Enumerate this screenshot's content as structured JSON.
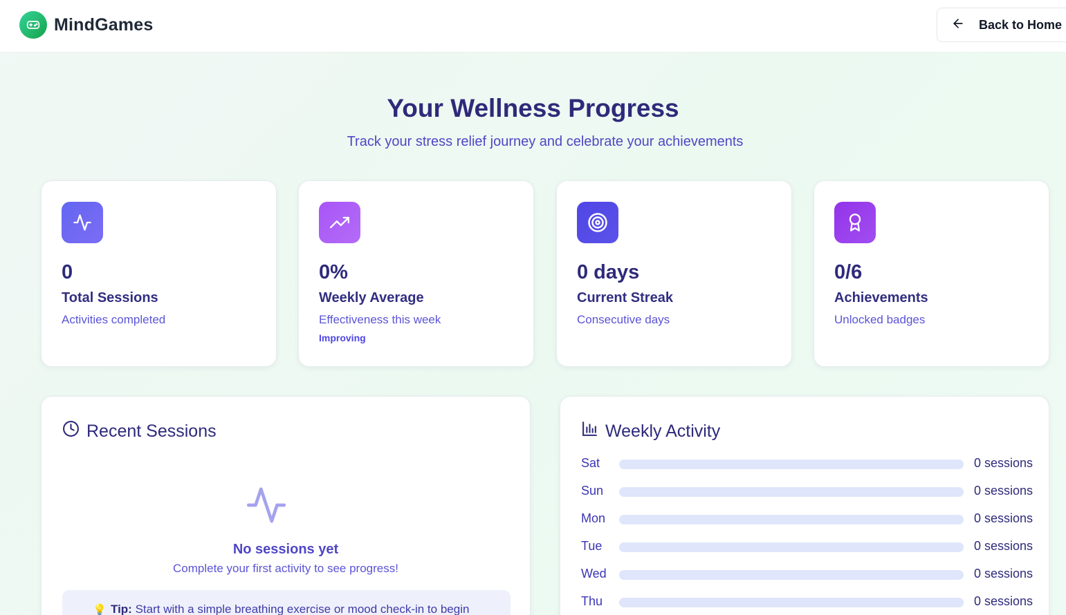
{
  "header": {
    "brand_name": "MindGames",
    "back_label": "Back to Home"
  },
  "hero": {
    "title": "Your Wellness Progress",
    "subtitle": "Track your stress relief journey and celebrate your achievements"
  },
  "stats": [
    {
      "icon": "activity-icon",
      "color": "#6366f1",
      "value": "0",
      "label": "Total Sessions",
      "desc": "Activities completed",
      "trend": ""
    },
    {
      "icon": "trending-up-icon",
      "color": "#a855f7",
      "value": "0%",
      "label": "Weekly Average",
      "desc": "Effectiveness this week",
      "trend": "Improving"
    },
    {
      "icon": "target-icon",
      "color": "#4f46e5",
      "value": "0 days",
      "label": "Current Streak",
      "desc": "Consecutive days",
      "trend": ""
    },
    {
      "icon": "award-icon",
      "color": "#9333ea",
      "value": "0/6",
      "label": "Achievements",
      "desc": "Unlocked badges",
      "trend": ""
    }
  ],
  "recent": {
    "title": "Recent Sessions",
    "empty_title": "No sessions yet",
    "empty_desc": "Complete your first activity to see progress!",
    "tip_label": "Tip:",
    "tip_text": " Start with a simple breathing exercise or mood check-in to begin"
  },
  "weekly": {
    "title": "Weekly Activity",
    "days": [
      {
        "day": "Sat",
        "count_label": "0 sessions",
        "fraction": 0
      },
      {
        "day": "Sun",
        "count_label": "0 sessions",
        "fraction": 0
      },
      {
        "day": "Mon",
        "count_label": "0 sessions",
        "fraction": 0
      },
      {
        "day": "Tue",
        "count_label": "0 sessions",
        "fraction": 0
      },
      {
        "day": "Wed",
        "count_label": "0 sessions",
        "fraction": 0
      },
      {
        "day": "Thu",
        "count_label": "0 sessions",
        "fraction": 0
      }
    ]
  }
}
